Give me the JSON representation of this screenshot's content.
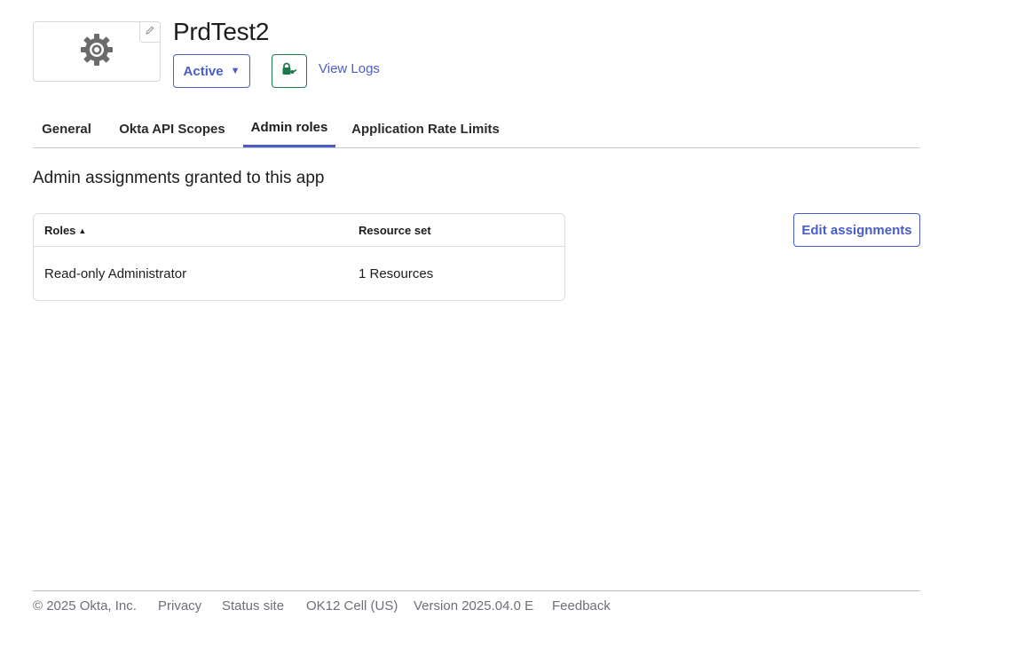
{
  "app": {
    "title": "PrdTest2",
    "status_label": "Active",
    "view_logs_label": "View Logs",
    "logo_icon": "gear-icon",
    "edit_logo_icon": "pencil-icon",
    "key_icon": "lock-key-icon"
  },
  "tabs": [
    {
      "label": "General",
      "active": false
    },
    {
      "label": "Okta API Scopes",
      "active": false
    },
    {
      "label": "Admin roles",
      "active": true
    },
    {
      "label": "Application Rate Limits",
      "active": false
    }
  ],
  "section": {
    "title": "Admin assignments granted to this app",
    "edit_button_label": "Edit assignments"
  },
  "table": {
    "columns": [
      {
        "label": "Roles",
        "sort": "▲"
      },
      {
        "label": "Resource set"
      }
    ],
    "rows": [
      {
        "role": "Read-only Administrator",
        "resource_set": "1 Resources"
      }
    ]
  },
  "footer": {
    "copyright": "© 2025 Okta, Inc.",
    "privacy": "Privacy",
    "status_site": "Status site",
    "cell": "OK12 Cell (US)",
    "version": "Version 2025.04.0 E",
    "feedback": "Feedback"
  },
  "colors": {
    "accent": "#4a5cc6",
    "key_green": "#1e7a4c",
    "muted_text": "#6e6e78"
  }
}
